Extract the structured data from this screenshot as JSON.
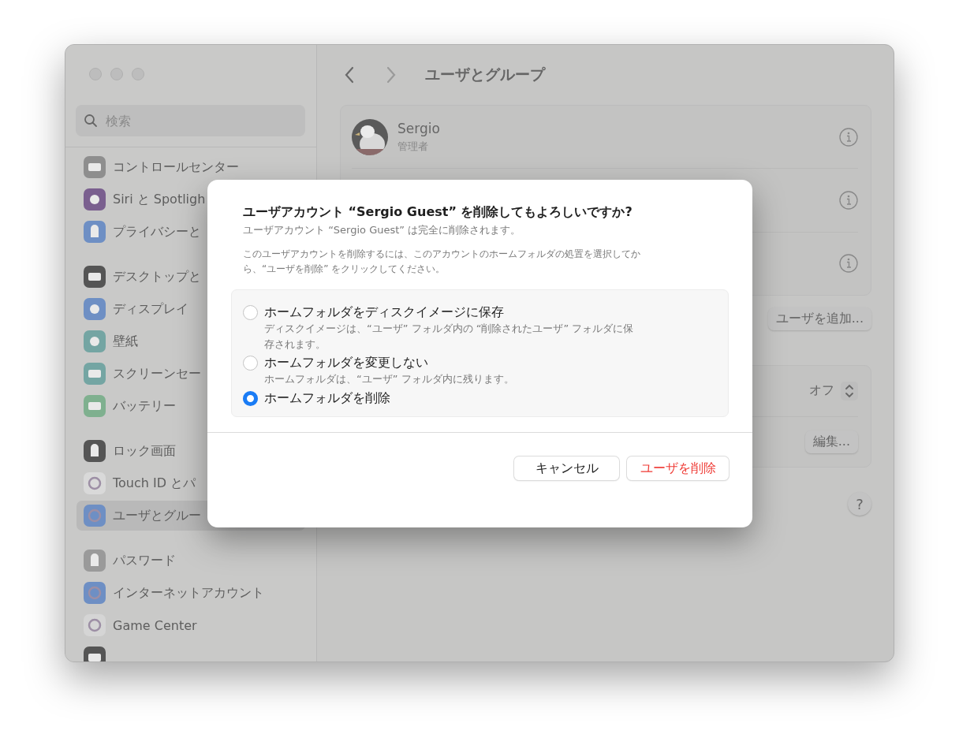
{
  "window": {
    "title": "ユーザとグループ"
  },
  "sidebar": {
    "search": {
      "placeholder": "検索"
    },
    "groups": [
      {
        "items": [
          {
            "label": "コントロールセンター",
            "kind": "toggles",
            "selected": false
          },
          {
            "label": "Siri と Spotligh",
            "kind": "siri",
            "selected": false
          },
          {
            "label": "プライバシーと",
            "kind": "hand",
            "selected": false
          }
        ]
      },
      {
        "items": [
          {
            "label": "デスクトップと",
            "kind": "dock",
            "selected": false
          },
          {
            "label": "ディスプレイ",
            "kind": "sun",
            "selected": false
          },
          {
            "label": "壁紙",
            "kind": "flower",
            "selected": false
          },
          {
            "label": "スクリーンセー",
            "kind": "screen",
            "selected": false
          },
          {
            "label": "バッテリー",
            "kind": "battery",
            "selected": false
          }
        ]
      },
      {
        "items": [
          {
            "label": "ロック画面",
            "kind": "lock",
            "selected": false
          },
          {
            "label": "Touch ID とパ",
            "kind": "fingerprint",
            "selected": false
          },
          {
            "label": "ユーザとグルー",
            "kind": "users",
            "selected": true
          }
        ]
      },
      {
        "items": [
          {
            "label": "パスワード",
            "kind": "key",
            "selected": false
          },
          {
            "label": "インターネットアカウント",
            "kind": "at",
            "selected": false
          },
          {
            "label": "Game Center",
            "kind": "bubbles",
            "selected": false
          },
          {
            "kind": "wallet",
            "selected": false
          }
        ]
      }
    ]
  },
  "user": {
    "name": "Sergio",
    "role": "管理者"
  },
  "add_user_button": "ユーザを追加...",
  "settings": [
    {
      "kind": "stepper",
      "value": "オフ"
    },
    {
      "kind": "button",
      "value": "編集..."
    }
  ],
  "help_button": "?",
  "dialog": {
    "title": "ユーザアカウント “Sergio Guest” を削除してもよろしいですか?",
    "subtitle": "ユーザアカウント “Sergio Guest” は完全に削除されます。",
    "instructions": "このユーザアカウントを削除するには、このアカウントのホームフォルダの処置を選択してから、“ユーザを削除” をクリックしてください。",
    "options": [
      {
        "label": "ホームフォルダをディスクイメージに保存",
        "description": "ディスクイメージは、“ユーザ” フォルダ内の “削除されたユーザ” フォルダに保存されます。",
        "selected": false
      },
      {
        "label": "ホームフォルダを変更しない",
        "description": "ホームフォルダは、“ユーザ” フォルダ内に残ります。",
        "selected": false
      },
      {
        "label": "ホームフォルダを削除",
        "selected": true
      }
    ],
    "buttons": [
      {
        "label": "キャンセル",
        "kind": "normal"
      },
      {
        "label": "ユーザを削除",
        "kind": "destructive"
      }
    ]
  }
}
